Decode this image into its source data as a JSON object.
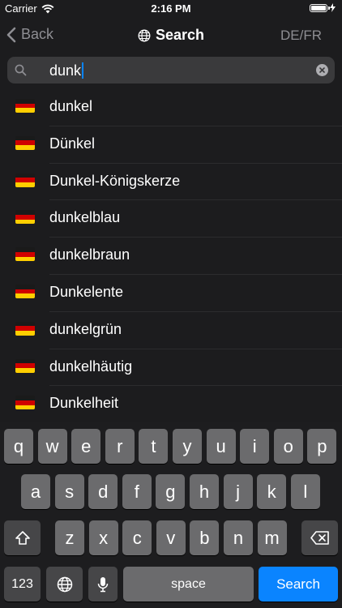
{
  "status_bar": {
    "carrier": "Carrier",
    "time": "2:16 PM"
  },
  "nav": {
    "back_label": "Back",
    "title": "Search",
    "lang_pair": "DE/FR"
  },
  "search": {
    "query": "dunk"
  },
  "flag_colors": [
    "#1a1a1a",
    "#d00000",
    "#ffce00"
  ],
  "results": [
    {
      "word": "dunkel"
    },
    {
      "word": "Dünkel"
    },
    {
      "word": "Dunkel-Königskerze"
    },
    {
      "word": "dunkelblau"
    },
    {
      "word": "dunkelbraun"
    },
    {
      "word": "Dunkelente"
    },
    {
      "word": "dunkelgrün"
    },
    {
      "word": "dunkelhäutig"
    },
    {
      "word": "Dunkelheit"
    }
  ],
  "keyboard": {
    "row1": [
      "q",
      "w",
      "e",
      "r",
      "t",
      "y",
      "u",
      "i",
      "o",
      "p"
    ],
    "row2": [
      "a",
      "s",
      "d",
      "f",
      "g",
      "h",
      "j",
      "k",
      "l"
    ],
    "row3": [
      "z",
      "x",
      "c",
      "v",
      "b",
      "n",
      "m"
    ],
    "numbers_label": "123",
    "space_label": "space",
    "return_label": "Search"
  }
}
